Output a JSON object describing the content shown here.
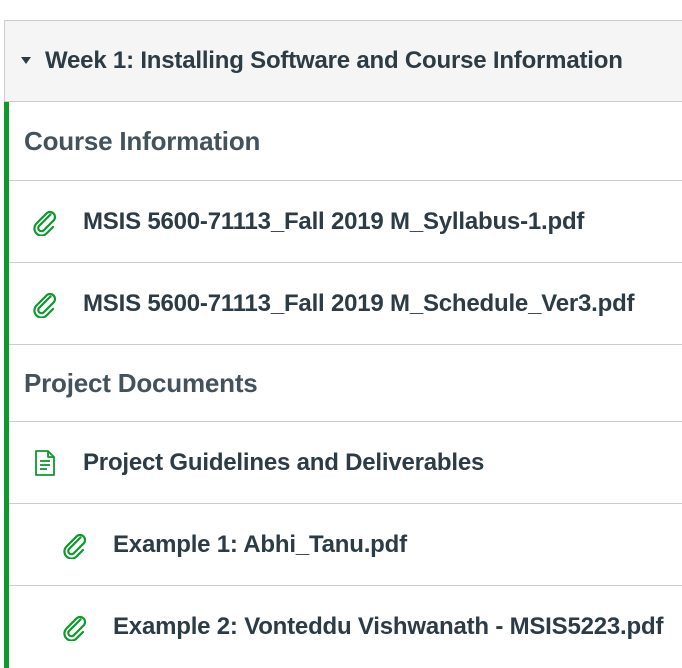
{
  "module": {
    "title": "Week 1: Installing Software and Course Information",
    "toggle_icon": "caret-down-icon"
  },
  "accent_color": "#0b9a2b",
  "items": [
    {
      "type": "subheader",
      "title": "Course Information"
    },
    {
      "type": "attachment",
      "icon": "paperclip-icon",
      "title": "MSIS 5600-71113_Fall 2019 M_Syllabus-1.pdf"
    },
    {
      "type": "attachment",
      "icon": "paperclip-icon",
      "title": "MSIS 5600-71113_Fall 2019 M_Schedule_Ver3.pdf"
    },
    {
      "type": "subheader",
      "title": "Project Documents"
    },
    {
      "type": "page",
      "icon": "document-icon",
      "title": "Project Guidelines and Deliverables"
    },
    {
      "type": "attachment",
      "icon": "paperclip-icon",
      "title": "Example 1: Abhi_Tanu.pdf",
      "indent": 1
    },
    {
      "type": "attachment",
      "icon": "paperclip-icon",
      "title": "Example 2: Vonteddu Vishwanath - MSIS5223.pdf",
      "indent": 1
    }
  ]
}
